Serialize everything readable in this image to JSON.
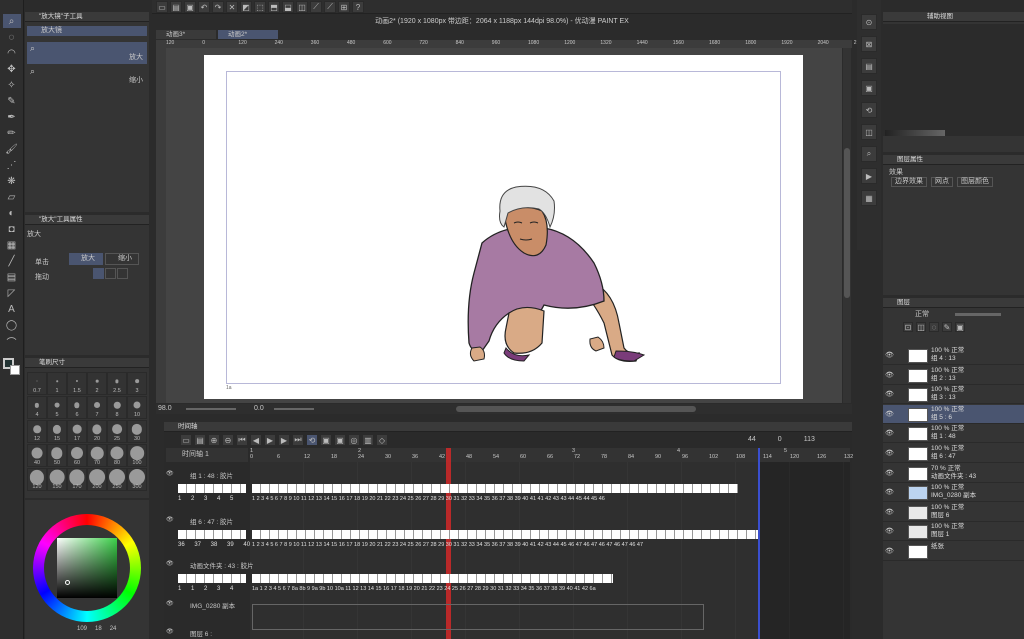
{
  "window": {
    "title": "动画2* (1920 x 1080px 带边距：2064 x 1188px 144dpi 98.0%) - 优动漫 PAINT EX"
  },
  "tabs": [
    {
      "label": "动画3*"
    },
    {
      "label": "动画2*"
    }
  ],
  "ruler": {
    "ticks": [
      "120",
      "0",
      "120",
      "240",
      "360",
      "480",
      "600",
      "720",
      "840",
      "960",
      "1080",
      "1200",
      "1320",
      "1440",
      "1560",
      "1680",
      "1800",
      "1920",
      "2040",
      "216"
    ]
  },
  "sub_tool": {
    "header": "\"放大镜\"子工具",
    "items": [
      {
        "label": "放大镜"
      },
      {
        "label": "放大"
      },
      {
        "label": "缩小"
      }
    ]
  },
  "tool_props": {
    "header": "\"放大\"工具属性",
    "tool_name": "放大",
    "click_label": "单击",
    "zoom_in": "放大",
    "zoom_out": "缩小",
    "drag_label": "拖动"
  },
  "brush_size": {
    "header": "笔刷尺寸",
    "sizes": [
      "0.7",
      "1",
      "1.5",
      "2",
      "2.5",
      "3",
      "4",
      "5",
      "6",
      "7",
      "8",
      "10",
      "12",
      "15",
      "17",
      "20",
      "25",
      "30",
      "40",
      "50",
      "60",
      "70",
      "80",
      "100",
      "120",
      "150",
      "170",
      "200",
      "250",
      "300"
    ]
  },
  "color_wheel": {
    "readout": [
      "109",
      "18",
      "24"
    ]
  },
  "status": {
    "zoom": "98.0",
    "rotation": "0.0"
  },
  "timeline": {
    "header": "时间轴",
    "track_name": "时间轴 1",
    "current_frame": "44",
    "total_a": "0",
    "total_b": "113",
    "ruler": [
      "0",
      "6",
      "12",
      "18",
      "24",
      "30",
      "36",
      "42",
      "48",
      "54",
      "60",
      "66",
      "72",
      "78",
      "84",
      "90",
      "96",
      "102",
      "108",
      "114",
      "120",
      "126",
      "132"
    ],
    "section_marks": [
      "1",
      "2",
      "3",
      "4",
      "5"
    ],
    "tracks": [
      {
        "name": "组 1 : 48 : 胶片",
        "left_nums": "1 2 3 4 5",
        "frames": "1 2 3 4 5 6 7 8 9 10 11 12 13 14 15 16 17 18 19 20 21 22 23 24 25 26 27 28 29 30 31 32 33 34 35 36 37 38 39 40 41 41 42 43 43 44 45 44 45 46"
      },
      {
        "name": "组 6 : 47 : 胶片",
        "left_nums": "36 37 38 39 40",
        "frames": "1 2 3 4 5 6 7 8 9 10 11 12 13 14 15 16 17 18 19 20 21 22 23 24 25 26 27 28 29 30 31 32 33 34 35 36 37 38 39 40 41 42 43 44 45 46 47 46 47 46 47 46 47 46 47"
      },
      {
        "name": "动画文件夹 : 43 : 胶片",
        "left_nums": "1 1 2 3 4",
        "frames": "1a 1 2 3 4 5 6 7 8a 8b 9 9a 9b 10 10a 11 12 13 14 15 16 17 18 19 20 21 22 23 24 25 26 27 28 29 30 31 32 33 34 35 36 37 38 39 40 41 42 6a"
      },
      {
        "name": "IMG_0280 副本",
        "left_nums": "",
        "frames": ""
      },
      {
        "name": "图层 6 :",
        "left_nums": "",
        "frames": ""
      }
    ]
  },
  "nav_panel": {
    "header": "辅助视图"
  },
  "effects": {
    "header": "图层属性",
    "title": "效果",
    "items": [
      "边界效果",
      "网点",
      "图层颜色"
    ]
  },
  "layers": {
    "header": "图层",
    "blend": "正常",
    "items": [
      {
        "pct": "100 %",
        "mode": "正常",
        "name": "组 4 : 13"
      },
      {
        "pct": "100 %",
        "mode": "正常",
        "name": "组 2 : 13"
      },
      {
        "pct": "100 %",
        "mode": "正常",
        "name": "组 3 : 13"
      },
      {
        "pct": "100 %",
        "mode": "正常",
        "name": "组 5 : 6"
      },
      {
        "pct": "100 %",
        "mode": "正常",
        "name": "组 1 : 48"
      },
      {
        "pct": "100 %",
        "mode": "正常",
        "name": "组 6 : 47"
      },
      {
        "pct": "70 %",
        "mode": "正常",
        "name": "动画文件夹 : 43"
      },
      {
        "pct": "100 %",
        "mode": "正常",
        "name": "IMG_0280 副本"
      },
      {
        "pct": "100 %",
        "mode": "正常",
        "name": "图层 6"
      },
      {
        "pct": "100 %",
        "mode": "正常",
        "name": "图层 1"
      },
      {
        "pct": "",
        "mode": "",
        "name": "纸张"
      }
    ]
  }
}
